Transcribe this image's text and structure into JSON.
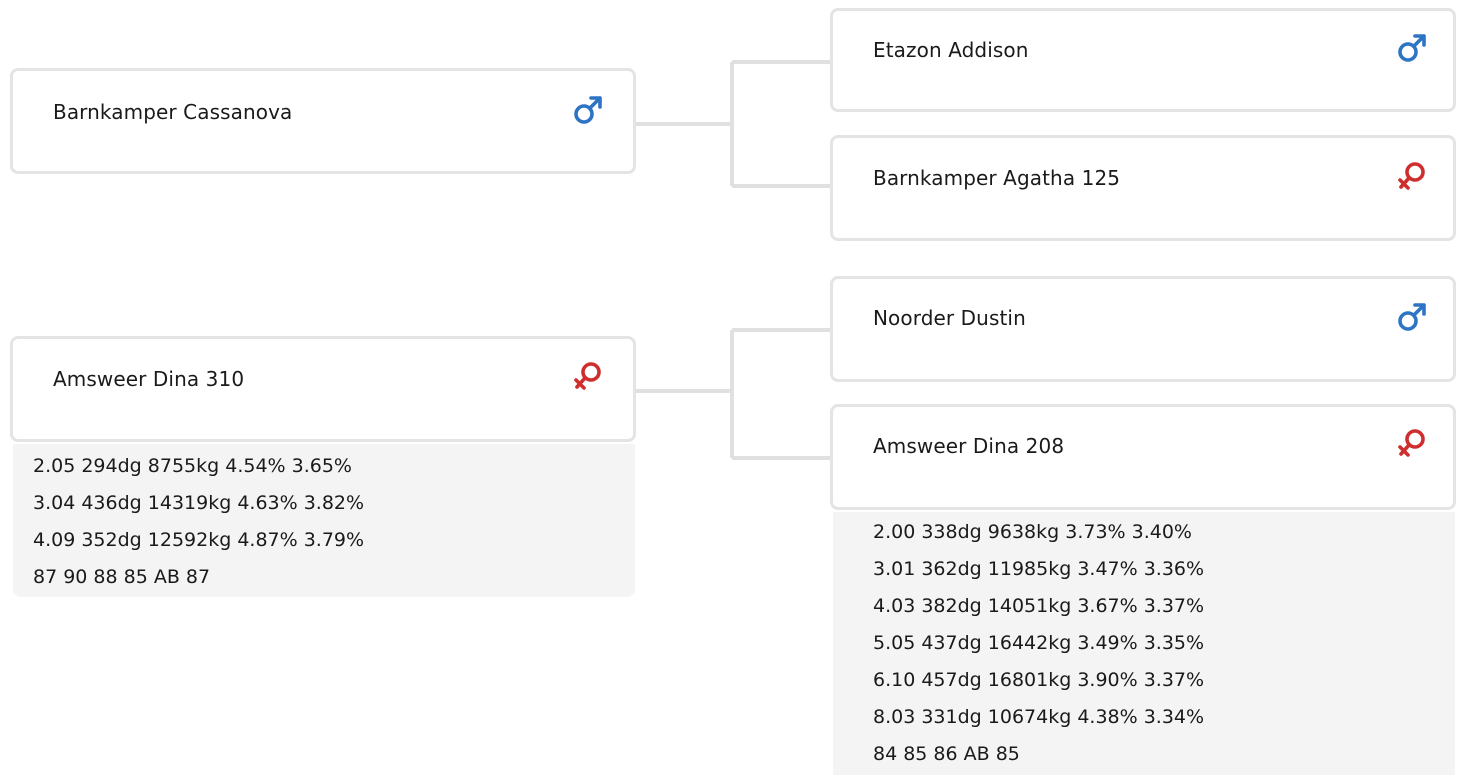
{
  "colors": {
    "male": "#2e74c4",
    "female": "#cf2e2e",
    "card_border": "#e4e4e4",
    "connector": "#e0e0e0",
    "stats_bg": "#f4f4f4"
  },
  "pedigree": {
    "sire": {
      "name": "Barnkamper Cassanova",
      "sex_icon": "male-icon",
      "sire": {
        "name": "Etazon Addison",
        "sex_icon": "male-icon"
      },
      "dam": {
        "name": "Barnkamper Agatha 125",
        "sex_icon": "female-icon"
      }
    },
    "dam": {
      "name": "Amsweer Dina 310",
      "sex_icon": "female-icon",
      "stats": [
        "2.05 294dg 8755kg 4.54% 3.65%",
        "3.04 436dg 14319kg 4.63% 3.82%",
        "4.09 352dg 12592kg 4.87% 3.79%",
        "87 90 88 85 AB 87"
      ],
      "sire": {
        "name": "Noorder Dustin",
        "sex_icon": "male-icon"
      },
      "dam": {
        "name": "Amsweer Dina 208",
        "sex_icon": "female-icon",
        "stats": [
          "2.00 338dg 9638kg 3.73% 3.40%",
          "3.01 362dg 11985kg 3.47% 3.36%",
          "4.03 382dg 14051kg 3.67% 3.37%",
          "5.05 437dg 16442kg 3.49% 3.35%",
          "6.10 457dg 16801kg 3.90% 3.37%",
          "8.03 331dg 10674kg 4.38% 3.34%",
          "84 85 86 AB 85"
        ]
      }
    }
  }
}
